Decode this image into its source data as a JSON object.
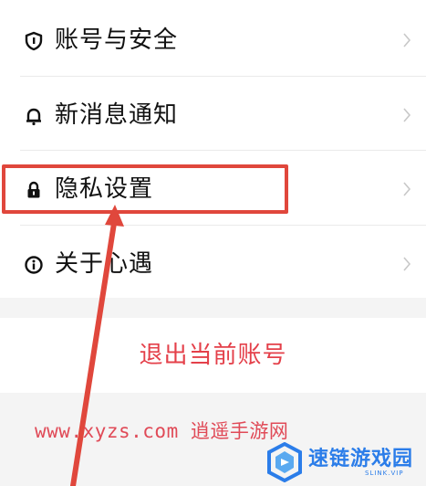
{
  "settings": {
    "items": [
      {
        "label": "账号与安全",
        "icon": "shield-icon"
      },
      {
        "label": "新消息通知",
        "icon": "bell-icon"
      },
      {
        "label": "隐私设置",
        "icon": "lock-icon"
      },
      {
        "label": "关于心遇",
        "icon": "info-icon"
      }
    ],
    "logout_label": "退出当前账号"
  },
  "annotation": {
    "highlight_color": "#e0473c",
    "watermark_text": "www.xyzs.com 逍遥手游网"
  },
  "brand": {
    "name": "速链游戏园",
    "sub": "SLINK.VIP",
    "color": "#2b7de9"
  }
}
